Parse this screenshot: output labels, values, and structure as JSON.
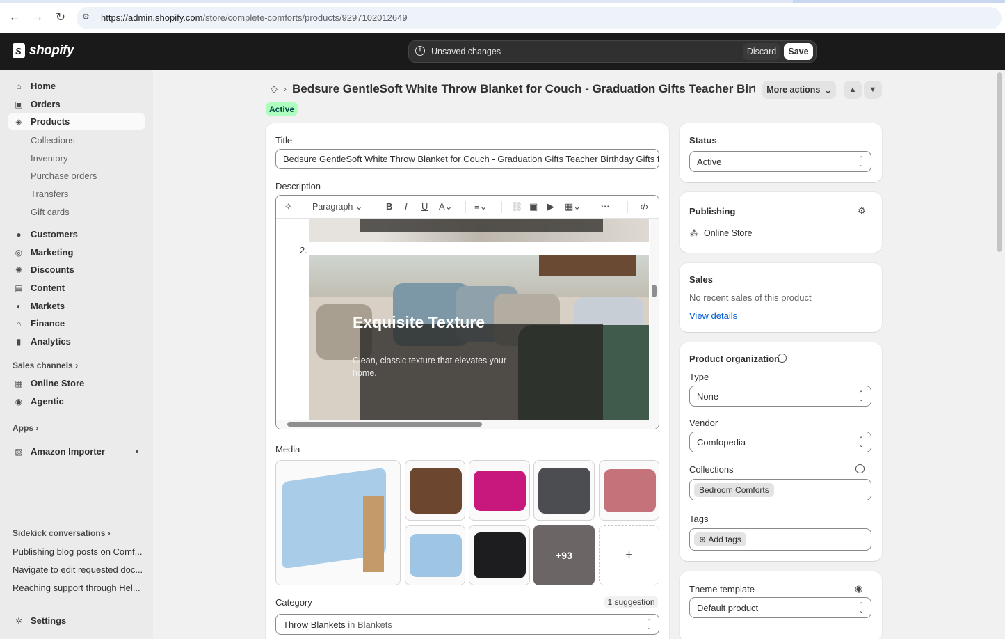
{
  "browser": {
    "url_host": "https://admin.shopify.com",
    "url_path": "/store/complete-comforts/products/9297102012649"
  },
  "topbar": {
    "brand": "shopify",
    "unsaved_text": "Unsaved changes",
    "discard_label": "Discard",
    "save_label": "Save"
  },
  "sidebar": {
    "items": [
      {
        "label": "Home",
        "icon": "home-icon"
      },
      {
        "label": "Orders",
        "icon": "inbox-icon"
      },
      {
        "label": "Products",
        "icon": "tag-icon"
      },
      {
        "label": "Customers",
        "icon": "person-icon"
      },
      {
        "label": "Marketing",
        "icon": "target-icon"
      },
      {
        "label": "Discounts",
        "icon": "discount-icon"
      },
      {
        "label": "Content",
        "icon": "content-icon"
      },
      {
        "label": "Markets",
        "icon": "globe-icon"
      },
      {
        "label": "Finance",
        "icon": "bank-icon"
      },
      {
        "label": "Analytics",
        "icon": "chart-bar-icon"
      }
    ],
    "product_subitems": [
      "Collections",
      "Inventory",
      "Purchase orders",
      "Transfers",
      "Gift cards"
    ],
    "sales_channels_label": "Sales channels",
    "channels": [
      {
        "label": "Online Store",
        "icon": "storefront-icon"
      },
      {
        "label": "Agentic",
        "icon": "agentic-icon"
      }
    ],
    "apps_label": "Apps",
    "apps": [
      {
        "label": "Amazon Importer",
        "icon": "app-icon"
      }
    ],
    "sidekick_label": "Sidekick conversations",
    "conversations": [
      "Publishing blog posts on Comf...",
      "Navigate to edit requested doc...",
      "Reaching support through Hel..."
    ],
    "settings_label": "Settings"
  },
  "page": {
    "title": "Bedsure GentleSoft White Throw Blanket for Couch - Graduation Gifts Teacher Birt...",
    "status_badge": "Active",
    "more_actions_label": "More actions"
  },
  "product": {
    "title_label": "Title",
    "title_value": "Bedsure GentleSoft White Throw Blanket for Couch - Graduation Gifts Teacher Birthday Gifts f",
    "description_label": "Description",
    "paragraph_style": "Paragraph",
    "list_number": "2.",
    "image_heading": "Exquisite Texture",
    "image_subtext": "Clean, classic texture that elevates your home.",
    "media_label": "Media",
    "media_more_count": "+93",
    "add_media": "+",
    "category_label": "Category",
    "category_suggestion": "1 suggestion",
    "category_value": "Throw Blankets",
    "category_in": "in",
    "category_parent": "Blankets"
  },
  "right": {
    "status_label": "Status",
    "status_value": "Active",
    "publishing_label": "Publishing",
    "publishing_channel": "Online Store",
    "sales_label": "Sales",
    "sales_text": "No recent sales of this product",
    "sales_link": "View details",
    "org_label": "Product organization",
    "type_label": "Type",
    "type_value": "None",
    "vendor_label": "Vendor",
    "vendor_value": "Comfopedia",
    "collections_label": "Collections",
    "collection_chip": "Bedroom Comforts",
    "tags_label": "Tags",
    "add_tags": "Add tags",
    "theme_label": "Theme template",
    "theme_value": "Default product"
  },
  "colors": {
    "accent_link": "#005bd3",
    "status_green": "#affebf",
    "topbar": "#1a1a1a"
  }
}
